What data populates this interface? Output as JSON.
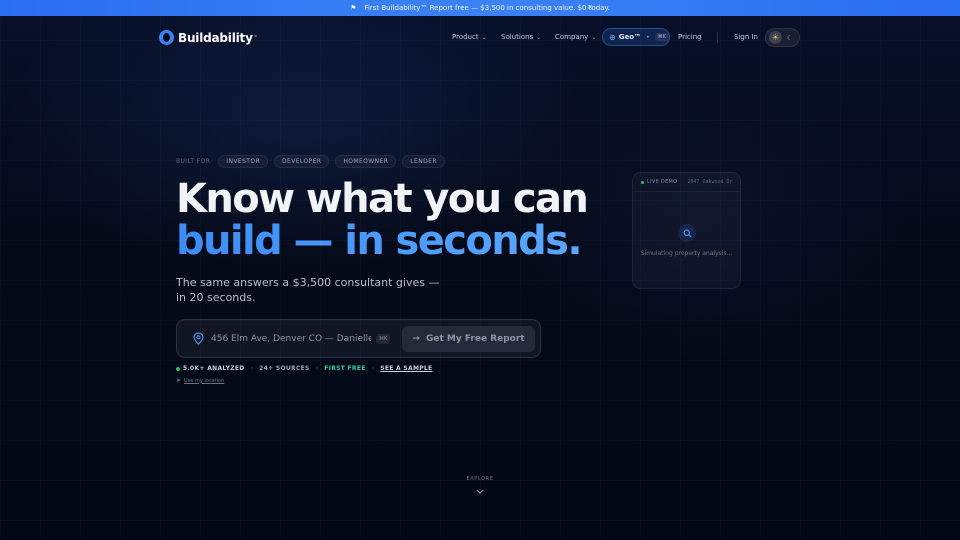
{
  "banner": {
    "text": "First Buildability™ Report free — $3,500 in consulting value. $0 today.",
    "close": "×"
  },
  "nav": {
    "logo_text": "Buildability",
    "logo_tm": "™",
    "items": [
      {
        "label": "Product"
      },
      {
        "label": "Solutions"
      },
      {
        "label": "Company"
      }
    ],
    "geo": {
      "label": "Geo™",
      "shortcut": "⌘K"
    },
    "pricing": "Pricing",
    "sign_in": "Sign In"
  },
  "hero": {
    "built_for_label": "BUILT FOR",
    "audiences": [
      "INVESTOR",
      "DEVELOPER",
      "HOMEOWNER",
      "LENDER"
    ],
    "headline_line1": "Know what you can",
    "headline_line2": "build — in seconds.",
    "subhead": "The same answers a $3,500 consultant gives — in 20 seconds."
  },
  "search": {
    "placeholder": "456 Elm Ave, Denver CO — Danielle ...",
    "shortcut": "⌘K",
    "cta": "Get My Free Report"
  },
  "stats": {
    "analyzed": "5.0K+ ANALYZED",
    "sources": "24+ SOURCES",
    "first_free": "FIRST FREE",
    "sample": "SEE A SAMPLE"
  },
  "use_location": "Use my location",
  "demo": {
    "live_label": "LIVE DEMO",
    "address": "2847 Oakwood Dr",
    "status": "Simulating property analysis..."
  },
  "explore": "EXPLORE",
  "colors": {
    "accent": "#3b82f6",
    "background": "#050a18",
    "success": "#22c55e"
  }
}
